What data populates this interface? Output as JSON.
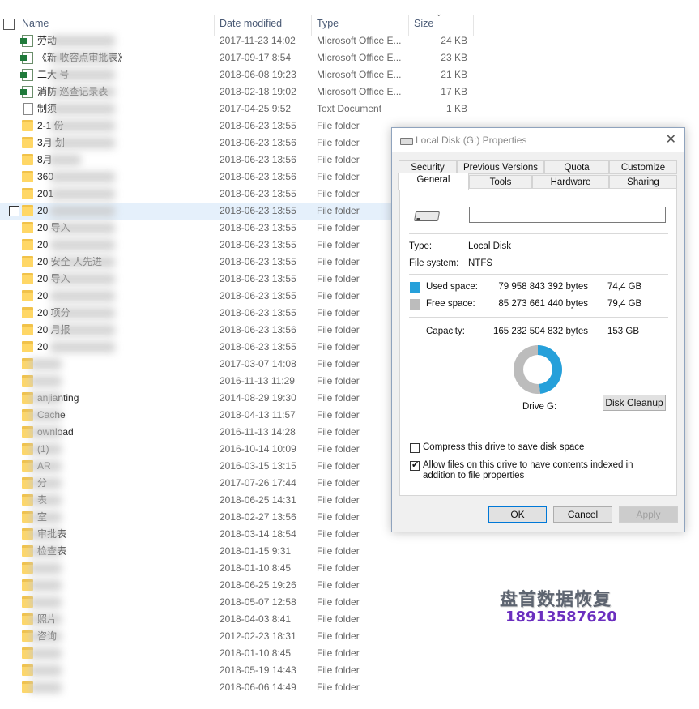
{
  "columns": {
    "name": "Name",
    "date": "Date modified",
    "type": "Type",
    "size": "Size"
  },
  "rows": [
    {
      "icon": "excel",
      "name": "劳动",
      "date": "2017-11-23 14:02",
      "type": "Microsoft Office E...",
      "size": "24 KB"
    },
    {
      "icon": "excel",
      "name": "《新              收容点审批表》",
      "date": "2017-09-17 8:54",
      "type": "Microsoft Office E...",
      "size": "23 KB"
    },
    {
      "icon": "excel",
      "name": "二大              号",
      "date": "2018-06-08 19:23",
      "type": "Microsoft Office E...",
      "size": "21 KB"
    },
    {
      "icon": "excel",
      "name": "消防            巡查记录表",
      "date": "2018-02-18 19:02",
      "type": "Microsoft Office E...",
      "size": "17 KB"
    },
    {
      "icon": "text",
      "name": "制须",
      "date": "2017-04-25 9:52",
      "type": "Text Document",
      "size": "1 KB"
    },
    {
      "icon": "folder",
      "name": "2-1            份",
      "date": "2018-06-23 13:55",
      "type": "File folder",
      "size": ""
    },
    {
      "icon": "folder",
      "name": "3月             划",
      "date": "2018-06-23 13:56",
      "type": "File folder",
      "size": ""
    },
    {
      "icon": "folder",
      "name": "8月",
      "date": "2018-06-23 13:56",
      "type": "File folder",
      "size": ""
    },
    {
      "icon": "folder",
      "name": "360",
      "date": "2018-06-23 13:56",
      "type": "File folder",
      "size": ""
    },
    {
      "icon": "folder",
      "name": "201",
      "date": "2018-06-23 13:55",
      "type": "File folder",
      "size": ""
    },
    {
      "icon": "folder",
      "name": "20",
      "date": "2018-06-23 13:55",
      "type": "File folder",
      "size": "",
      "selected": true
    },
    {
      "icon": "folder",
      "name": "20          导入",
      "date": "2018-06-23 13:55",
      "type": "File folder",
      "size": ""
    },
    {
      "icon": "folder",
      "name": "20",
      "date": "2018-06-23 13:55",
      "type": "File folder",
      "size": ""
    },
    {
      "icon": "folder",
      "name": "20          安全            人先进",
      "date": "2018-06-23 13:55",
      "type": "File folder",
      "size": ""
    },
    {
      "icon": "folder",
      "name": "20          导入",
      "date": "2018-06-23 13:55",
      "type": "File folder",
      "size": ""
    },
    {
      "icon": "folder",
      "name": "20",
      "date": "2018-06-23 13:55",
      "type": "File folder",
      "size": ""
    },
    {
      "icon": "folder",
      "name": "20          项分",
      "date": "2018-06-23 13:55",
      "type": "File folder",
      "size": ""
    },
    {
      "icon": "folder",
      "name": "20          月报",
      "date": "2018-06-23 13:56",
      "type": "File folder",
      "size": ""
    },
    {
      "icon": "folder",
      "name": "20",
      "date": "2018-06-23 13:55",
      "type": "File folder",
      "size": ""
    },
    {
      "icon": "folder",
      "name": "",
      "date": "2017-03-07 14:08",
      "type": "File folder",
      "size": ""
    },
    {
      "icon": "folder",
      "name": "",
      "date": "2016-11-13 11:29",
      "type": "File folder",
      "size": ""
    },
    {
      "icon": "folder",
      "name": "        anjianting",
      "date": "2014-08-29 19:30",
      "type": "File folder",
      "size": ""
    },
    {
      "icon": "folder",
      "name": "        Cache",
      "date": "2018-04-13 11:57",
      "type": "File folder",
      "size": ""
    },
    {
      "icon": "folder",
      "name": "        ownload",
      "date": "2016-11-13 14:28",
      "type": "File folder",
      "size": ""
    },
    {
      "icon": "folder",
      "name": "        (1)",
      "date": "2016-10-14 10:09",
      "type": "File folder",
      "size": ""
    },
    {
      "icon": "folder",
      "name": "        AR",
      "date": "2016-03-15 13:15",
      "type": "File folder",
      "size": ""
    },
    {
      "icon": "folder",
      "name": "        分",
      "date": "2017-07-26 17:44",
      "type": "File folder",
      "size": ""
    },
    {
      "icon": "folder",
      "name": "        表",
      "date": "2018-06-25 14:31",
      "type": "File folder",
      "size": ""
    },
    {
      "icon": "folder",
      "name": "        室",
      "date": "2018-02-27 13:56",
      "type": "File folder",
      "size": ""
    },
    {
      "icon": "folder",
      "name": "        审批表",
      "date": "2018-03-14 18:54",
      "type": "File folder",
      "size": ""
    },
    {
      "icon": "folder",
      "name": "        检查表",
      "date": "2018-01-15 9:31",
      "type": "File folder",
      "size": ""
    },
    {
      "icon": "folder",
      "name": "",
      "date": "2018-01-10 8:45",
      "type": "File folder",
      "size": ""
    },
    {
      "icon": "folder",
      "name": "",
      "date": "2018-06-25 19:26",
      "type": "File folder",
      "size": ""
    },
    {
      "icon": "folder",
      "name": "",
      "date": "2018-05-07 12:58",
      "type": "File folder",
      "size": ""
    },
    {
      "icon": "folder",
      "name": "        照片",
      "date": "2018-04-03 8:41",
      "type": "File folder",
      "size": ""
    },
    {
      "icon": "folder",
      "name": "        咨询",
      "date": "2012-02-23 18:31",
      "type": "File folder",
      "size": ""
    },
    {
      "icon": "folder",
      "name": "",
      "date": "2018-01-10 8:45",
      "type": "File folder",
      "size": ""
    },
    {
      "icon": "folder",
      "name": "",
      "date": "2018-05-19 14:43",
      "type": "File folder",
      "size": ""
    },
    {
      "icon": "folder",
      "name": "",
      "date": "2018-06-06 14:49",
      "type": "File folder",
      "size": ""
    }
  ],
  "dialog": {
    "title": "Local Disk (G:) Properties",
    "tabs_top": [
      "Security",
      "Previous Versions",
      "Quota",
      "Customize"
    ],
    "tabs_bottom": [
      "General",
      "Tools",
      "Hardware",
      "Sharing"
    ],
    "active_tab": "General",
    "drive_name_value": "",
    "type_label": "Type:",
    "type_value": "Local Disk",
    "fs_label": "File system:",
    "fs_value": "NTFS",
    "used_label": "Used space:",
    "used_bytes": "79 958 843 392 bytes",
    "used_gb": "74,4 GB",
    "free_label": "Free space:",
    "free_bytes": "85 273 661 440 bytes",
    "free_gb": "79,4 GB",
    "capacity_label": "Capacity:",
    "capacity_bytes": "165 232 504 832 bytes",
    "capacity_gb": "153 GB",
    "used_fraction": 0.484,
    "used_color": "#26a0da",
    "free_color": "#bcbcbc",
    "drive_label": "Drive G:",
    "disk_cleanup": "Disk Cleanup",
    "compress_label": "Compress this drive to save disk space",
    "compress_checked": false,
    "index_label": "Allow files on this drive to have contents indexed in addition to file properties",
    "index_checked": true,
    "ok": "OK",
    "cancel": "Cancel",
    "apply": "Apply"
  },
  "watermark": {
    "line1": "盘首数据恢复",
    "line2": "18913587620"
  }
}
